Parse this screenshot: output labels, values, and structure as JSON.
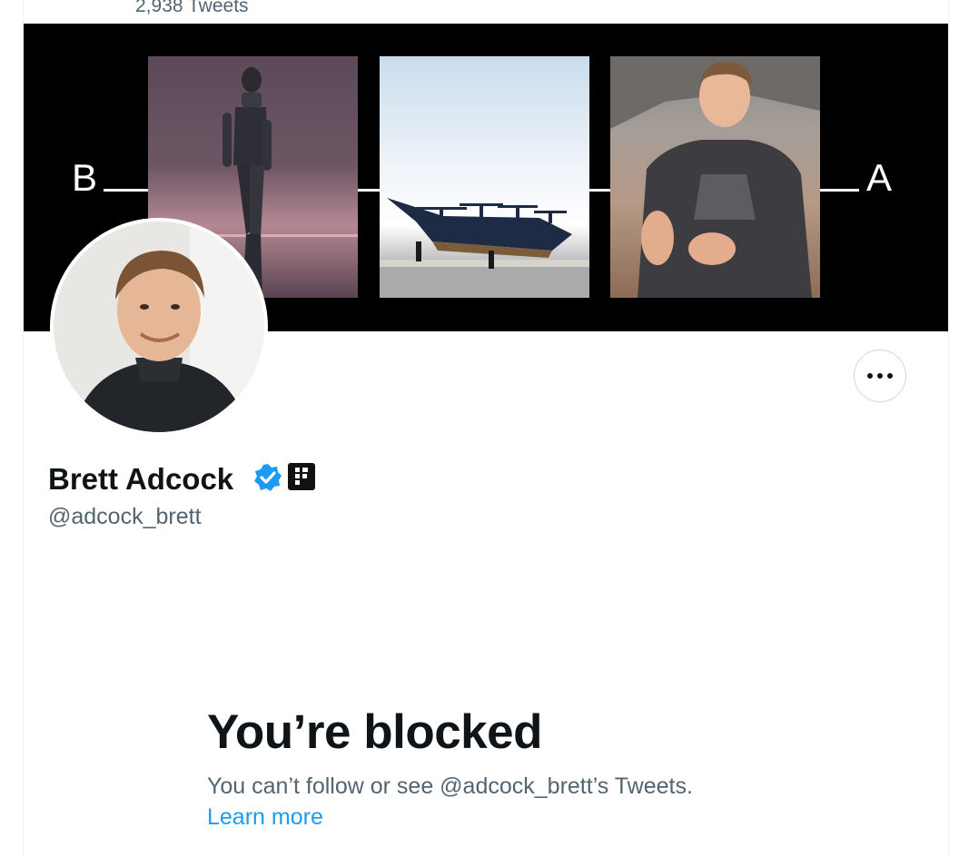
{
  "profile": {
    "tweet_count": "2,938 Tweets",
    "display_name": "Brett Adcock",
    "handle": "@adcock_brett",
    "verified": true
  },
  "banner": {
    "left_letter": "B",
    "right_letter": "A"
  },
  "actions": {
    "more_label": "More"
  },
  "blocked": {
    "title": "You’re blocked",
    "message": "You can’t follow or see @adcock_brett’s Tweets.",
    "learn_more": "Learn more"
  },
  "colors": {
    "accent": "#1d9bf0",
    "text_primary": "#0f1419",
    "text_secondary": "#536471",
    "verified_badge": "#1d9bf0"
  },
  "icons": {
    "more": "more-horizontal-icon",
    "verified": "verified-badge-icon",
    "affiliate": "figure-logo-icon"
  }
}
